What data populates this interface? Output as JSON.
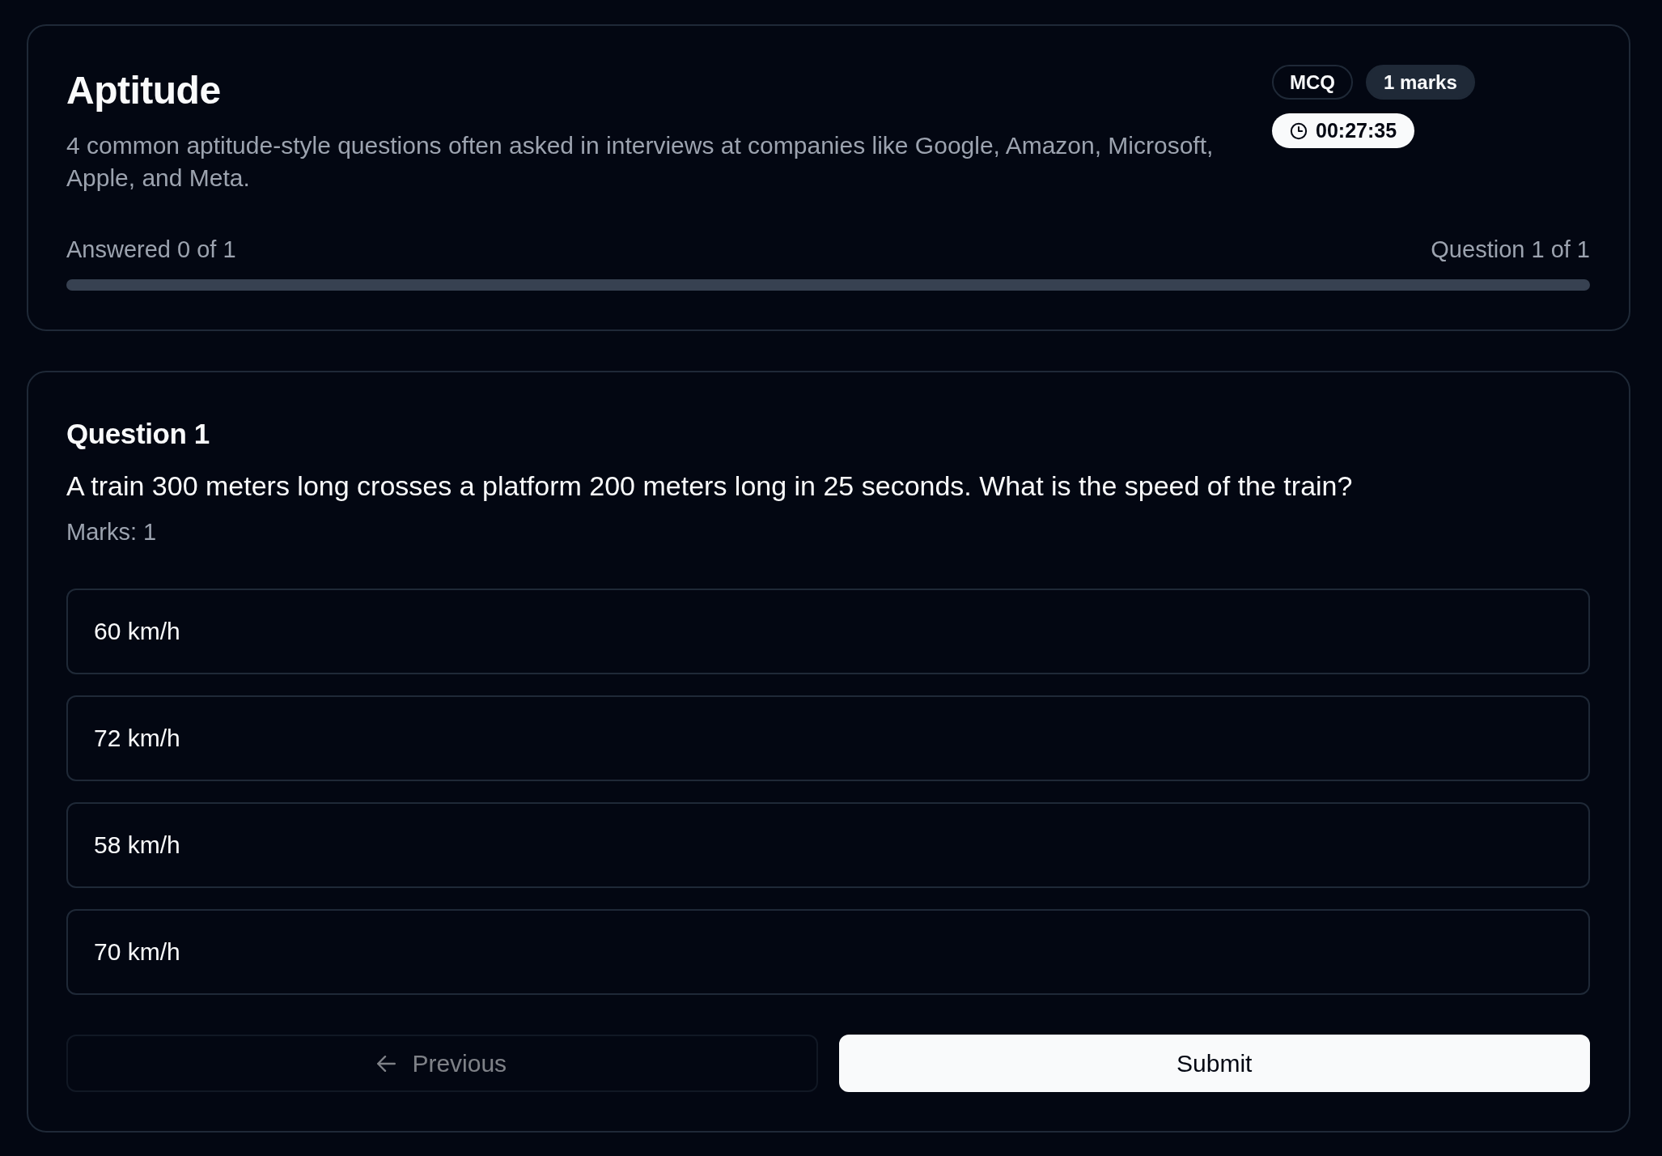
{
  "quiz": {
    "title": "Aptitude",
    "description": "4 common aptitude-style questions often asked in interviews at companies like Google, Amazon, Microsoft, Apple, and Meta.",
    "badges": [
      {
        "kind": "outline",
        "label": "MCQ"
      },
      {
        "kind": "secondary",
        "label": "1 marks"
      }
    ],
    "timer": {
      "label": "00:27:35"
    },
    "progress": {
      "answered_label": "Answered 0 of 1",
      "position_label": "Question 1 of 1"
    }
  },
  "question": {
    "heading": "Question 1",
    "text": "A train 300 meters long crosses a platform 200 meters long in 25 seconds. What is the speed of the train?",
    "marks": "Marks: 1",
    "options": [
      {
        "label": "60 km/h",
        "selected": false
      },
      {
        "label": "72 km/h",
        "selected": false
      },
      {
        "label": "58 km/h",
        "selected": false
      },
      {
        "label": "70 km/h",
        "selected": false
      }
    ]
  },
  "navigation": {
    "buttons": [
      {
        "kind": "back",
        "label": "Previous",
        "disabled": true
      },
      {
        "kind": "primary",
        "label": "Submit",
        "disabled": false
      }
    ]
  }
}
